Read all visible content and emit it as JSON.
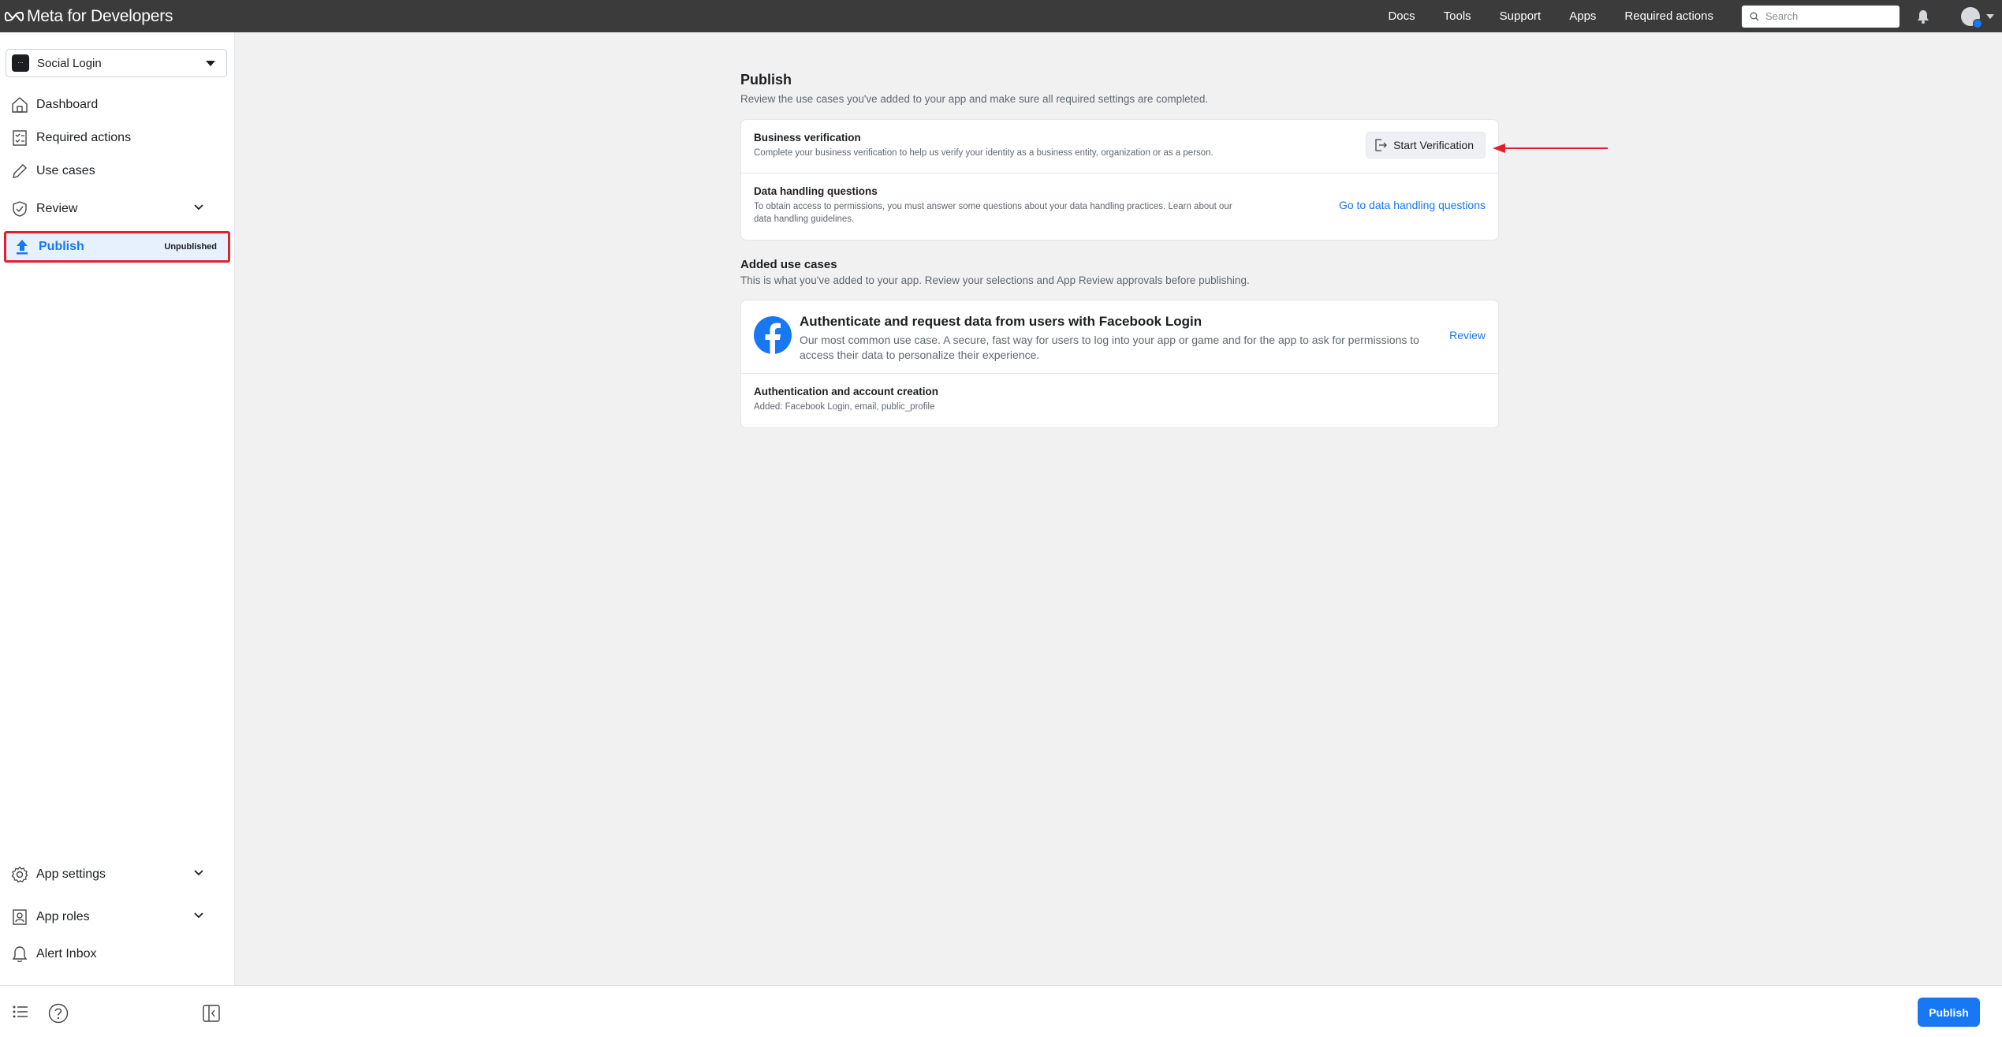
{
  "topbar": {
    "brand": "Meta for Developers",
    "nav": [
      "Docs",
      "Tools",
      "Support",
      "Apps",
      "Required actions"
    ],
    "search_placeholder": "Search"
  },
  "sidebar": {
    "app_name": "Social Login",
    "items": {
      "dashboard": "Dashboard",
      "required_actions": "Required actions",
      "use_cases": "Use cases",
      "review": "Review",
      "publish": "Publish",
      "publish_status": "Unpublished",
      "app_settings": "App settings",
      "app_roles": "App roles",
      "alert_inbox": "Alert Inbox"
    }
  },
  "main": {
    "publish_title": "Publish",
    "publish_sub": "Review the use cases you've added to your app and make sure all required settings are completed.",
    "business": {
      "title": "Business verification",
      "desc": "Complete your business verification to help us verify your identity as a business entity, organization or as a person.",
      "button": "Start Verification"
    },
    "data_handling": {
      "title": "Data handling questions",
      "desc": "To obtain access to permissions, you must answer some questions about your data handling practices. Learn about our data handling guidelines.",
      "link": "Go to data handling questions"
    },
    "added_title": "Added use cases",
    "added_sub": "This is what you've added to your app. Review your selections and App Review approvals before publishing.",
    "use_case": {
      "title": "Authenticate and request data from users with Facebook Login",
      "desc": "Our most common use case. A secure, fast way for users to log into your app or game and for the app to ask for permissions to access their data to personalize their experience.",
      "link": "Review"
    },
    "auth": {
      "title": "Authentication and account creation",
      "desc": "Added: Facebook Login, email, public_profile"
    }
  },
  "footer": {
    "publish_button": "Publish"
  },
  "colors": {
    "accent": "#1877f2",
    "highlight": "#e0202c",
    "topbar": "#3b3b3b"
  }
}
